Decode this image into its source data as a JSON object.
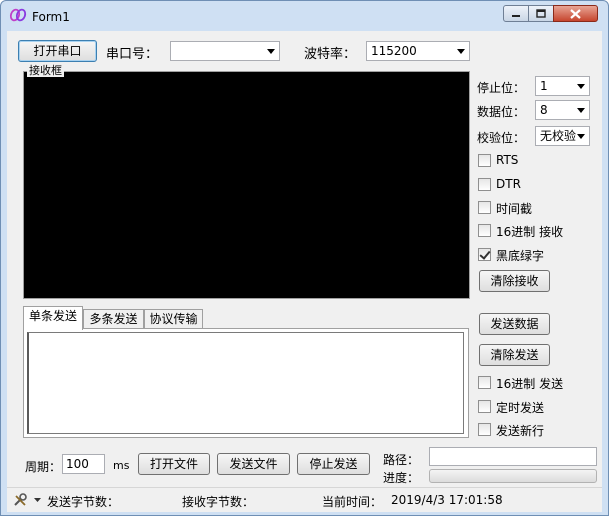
{
  "window": {
    "title": "Form1"
  },
  "toolbar": {
    "open_port_label": "打开串口",
    "port_label": "串口号：",
    "port_value": "",
    "baud_label": "波特率：",
    "baud_value": "115200"
  },
  "receive": {
    "group_label": "接收框",
    "stop_bits_label": "停止位：",
    "stop_bits_value": "1",
    "data_bits_label": "数据位：",
    "data_bits_value": "8",
    "parity_label": "校验位：",
    "parity_value": "无校验",
    "rts_label": "RTS",
    "dtr_label": "DTR",
    "timestamp_label": "时间截",
    "hex_receive_label": "16进制 接收",
    "black_green_label": "黑底绿字",
    "black_green_checked": true,
    "clear_receive_label": "清除接收"
  },
  "send": {
    "tabs": [
      {
        "label": "单条发送"
      },
      {
        "label": "多条发送"
      },
      {
        "label": "协议传输"
      }
    ],
    "send_data_label": "发送数据",
    "clear_send_label": "清除发送",
    "hex_send_label": "16进制 发送",
    "timed_send_label": "定时发送",
    "newline_label": "发送新行"
  },
  "bottom": {
    "period_label": "周期：",
    "period_value": "100",
    "period_unit": "ms",
    "open_file_label": "打开文件",
    "send_file_label": "发送文件",
    "stop_send_label": "停止发送",
    "path_label": "路径：",
    "path_value": "",
    "progress_label": "进度：",
    "progress_fraction": 0
  },
  "status": {
    "send_bytes_label": "发送字节数：",
    "receive_bytes_label": "接收字节数：",
    "current_time_label": "当前时间：",
    "current_time_value": "2019/4/3 17:01:58"
  },
  "icons": {
    "app": "app-loop-icon",
    "tools": "tools-icon",
    "accent": "#3c7fb1",
    "close_red": "#c6452e"
  }
}
